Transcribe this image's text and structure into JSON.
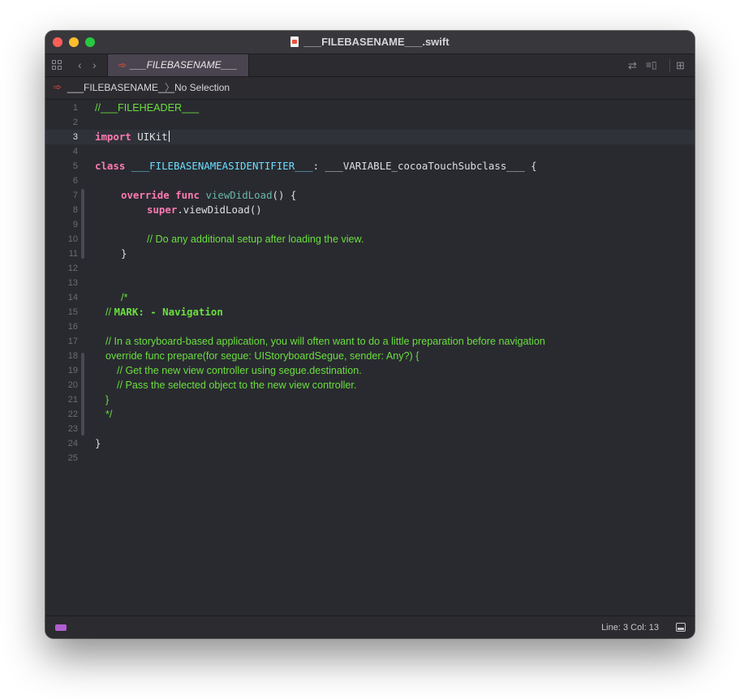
{
  "window": {
    "title": "___FILEBASENAME___.swift"
  },
  "tab": {
    "label": "___FILEBASENAME___"
  },
  "jumpbar": {
    "file": "___FILEBASENAME___",
    "separator": "〉",
    "selection": "No Selection"
  },
  "editor": {
    "lines": [
      {
        "n": "1",
        "text": "//___FILEHEADER___"
      },
      {
        "n": "2",
        "text": ""
      },
      {
        "n": "3",
        "kw": "import",
        "rest": " UIKit"
      },
      {
        "n": "4",
        "text": ""
      },
      {
        "n": "5",
        "kw": "class",
        "ident": "___FILEBASENAMEASIDENTIFIER___",
        "rest": ": ___VARIABLE_cocoaTouchSubclass___ {"
      },
      {
        "n": "6",
        "text": ""
      },
      {
        "n": "7",
        "kw": "override",
        "kw2": "func",
        "method": "viewDidLoad",
        "rest": "() {"
      },
      {
        "n": "8",
        "kw": "super",
        "rest": ".viewDidLoad()"
      },
      {
        "n": "9",
        "text": ""
      },
      {
        "n": "10",
        "text": "// Do any additional setup after loading the view."
      },
      {
        "n": "11",
        "text": "}"
      },
      {
        "n": "12",
        "text": ""
      },
      {
        "n": "13",
        "text": ""
      },
      {
        "n": "14",
        "text": "/*"
      },
      {
        "n": "15",
        "prefix": "// ",
        "mark": "MARK: - Navigation"
      },
      {
        "n": "16",
        "text": ""
      },
      {
        "n": "17",
        "text": "// In a storyboard-based application, you will often want to do a little preparation before navigation"
      },
      {
        "n": "18",
        "text": "override func prepare(for segue: UIStoryboardSegue, sender: Any?) {"
      },
      {
        "n": "19",
        "text": "// Get the new view controller using segue.destination."
      },
      {
        "n": "20",
        "text": "// Pass the selected object to the new view controller."
      },
      {
        "n": "21",
        "text": "}"
      },
      {
        "n": "22",
        "text": "*/"
      },
      {
        "n": "23",
        "text": ""
      },
      {
        "n": "24",
        "text": "}"
      },
      {
        "n": "25",
        "text": ""
      }
    ]
  },
  "status": {
    "cursor": "Line: 3  Col: 13"
  },
  "icons": {
    "grid": "grid-icon",
    "back": "chevron-left-icon",
    "forward": "chevron-right-icon",
    "swift": "swift-icon",
    "related": "arrows-swap-icon",
    "editor-options": "editor-options-icon",
    "add-editor": "add-editor-icon",
    "panel": "panel-icon"
  },
  "colors": {
    "background": "#292a30",
    "keyword": "#ff7ab2",
    "comment": "#6bdf3e",
    "identifier": "#6bdfff",
    "method": "#67b7a4",
    "plain": "#dfdfe0"
  }
}
